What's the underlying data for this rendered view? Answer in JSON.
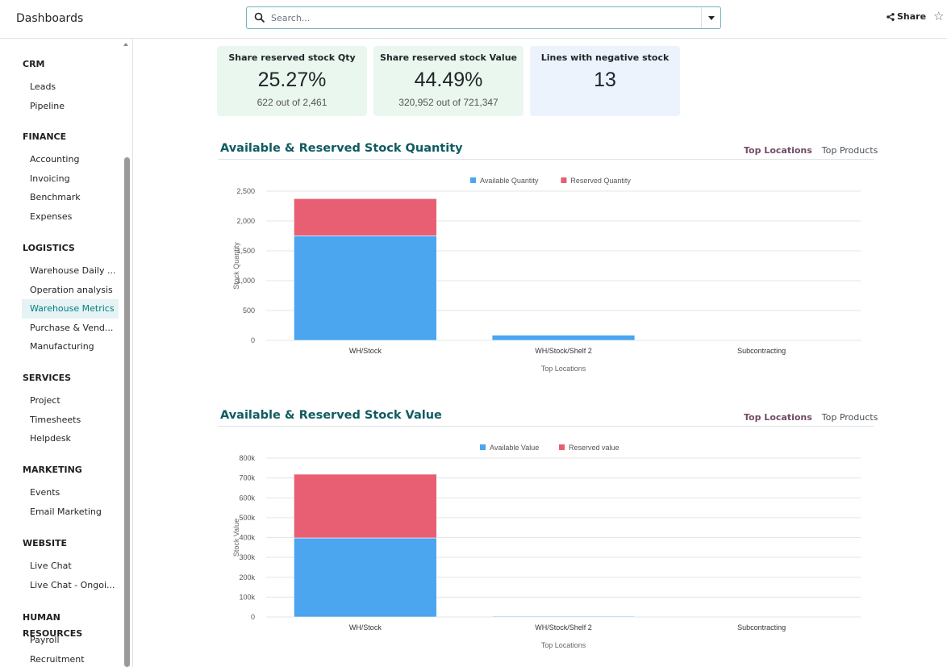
{
  "header": {
    "app_title": "Dashboards",
    "search_placeholder": "Search...",
    "share_label": "Share"
  },
  "sidebar": {
    "sections": [
      {
        "title": "CRM",
        "items": [
          {
            "label": "Leads"
          },
          {
            "label": "Pipeline"
          }
        ]
      },
      {
        "title": "FINANCE",
        "items": [
          {
            "label": "Accounting"
          },
          {
            "label": "Invoicing"
          },
          {
            "label": "Benchmark"
          },
          {
            "label": "Expenses"
          }
        ]
      },
      {
        "title": "LOGISTICS",
        "items": [
          {
            "label": "Warehouse Daily ..."
          },
          {
            "label": "Operation analysis"
          },
          {
            "label": "Warehouse Metrics",
            "active": true
          },
          {
            "label": "Purchase & Vend..."
          },
          {
            "label": "Manufacturing"
          }
        ]
      },
      {
        "title": "SERVICES",
        "items": [
          {
            "label": "Project"
          },
          {
            "label": "Timesheets"
          },
          {
            "label": "Helpdesk"
          }
        ]
      },
      {
        "title": "MARKETING",
        "items": [
          {
            "label": "Events"
          },
          {
            "label": "Email Marketing"
          }
        ]
      },
      {
        "title": "WEBSITE",
        "items": [
          {
            "label": "Live Chat"
          },
          {
            "label": "Live Chat - Ongoi..."
          }
        ]
      },
      {
        "title": "HUMAN RESOURCES",
        "items": [
          {
            "label": "Payroll"
          },
          {
            "label": "Recruitment"
          }
        ]
      }
    ]
  },
  "kpis": [
    {
      "title": "Share reserved stock Qty",
      "value": "25.27%",
      "sub": "622 out of 2,461",
      "color": "#eaf7ee"
    },
    {
      "title": "Share reserved stock Value",
      "value": "44.49%",
      "sub": "320,952 out of 721,347",
      "color": "#eaf7ee"
    },
    {
      "title": "Lines with negative stock",
      "value": "13",
      "sub": "",
      "color": "#edf3fc"
    }
  ],
  "sections": [
    {
      "title": "Available & Reserved Stock Quantity",
      "tab_active": "Top Locations",
      "tab_other": "Top Products"
    },
    {
      "title": "Available & Reserved Stock Value",
      "tab_active": "Top Locations",
      "tab_other": "Top Products"
    }
  ],
  "colors": {
    "available": "#4ba5ef",
    "reserved": "#e85e72"
  },
  "chart_data": [
    {
      "type": "bar",
      "stacked": true,
      "categories": [
        "WH/Stock",
        "WH/Stock/Shelf 2",
        "Subcontracting"
      ],
      "series": [
        {
          "name": "Available Quantity",
          "values": [
            1752,
            87,
            0
          ]
        },
        {
          "name": "Reserved Quantity",
          "values": [
            622,
            0,
            0
          ]
        }
      ],
      "xlabel": "Top Locations",
      "ylabel": "Stock Quantity",
      "ylim": [
        0,
        2500
      ],
      "yticks": [
        0,
        500,
        1000,
        1500,
        2000,
        2500
      ],
      "ytick_labels": [
        "0",
        "500",
        "1,000",
        "1,500",
        "2,000",
        "2,500"
      ],
      "legend": "top-center",
      "grid": true
    },
    {
      "type": "bar",
      "stacked": true,
      "categories": [
        "WH/Stock",
        "WH/Stock/Shelf 2",
        "Subcontracting"
      ],
      "series": [
        {
          "name": "Available Value",
          "values": [
            398000,
            2500,
            0
          ]
        },
        {
          "name": "Reserved value",
          "values": [
            320952,
            0,
            0
          ]
        }
      ],
      "xlabel": "Top Locations",
      "ylabel": "Stock Value",
      "ylim": [
        0,
        800000
      ],
      "yticks": [
        0,
        100000,
        200000,
        300000,
        400000,
        500000,
        600000,
        700000,
        800000
      ],
      "ytick_labels": [
        "0",
        "100k",
        "200k",
        "300k",
        "400k",
        "500k",
        "600k",
        "700k",
        "800k"
      ],
      "legend": "top-center",
      "grid": true
    }
  ]
}
